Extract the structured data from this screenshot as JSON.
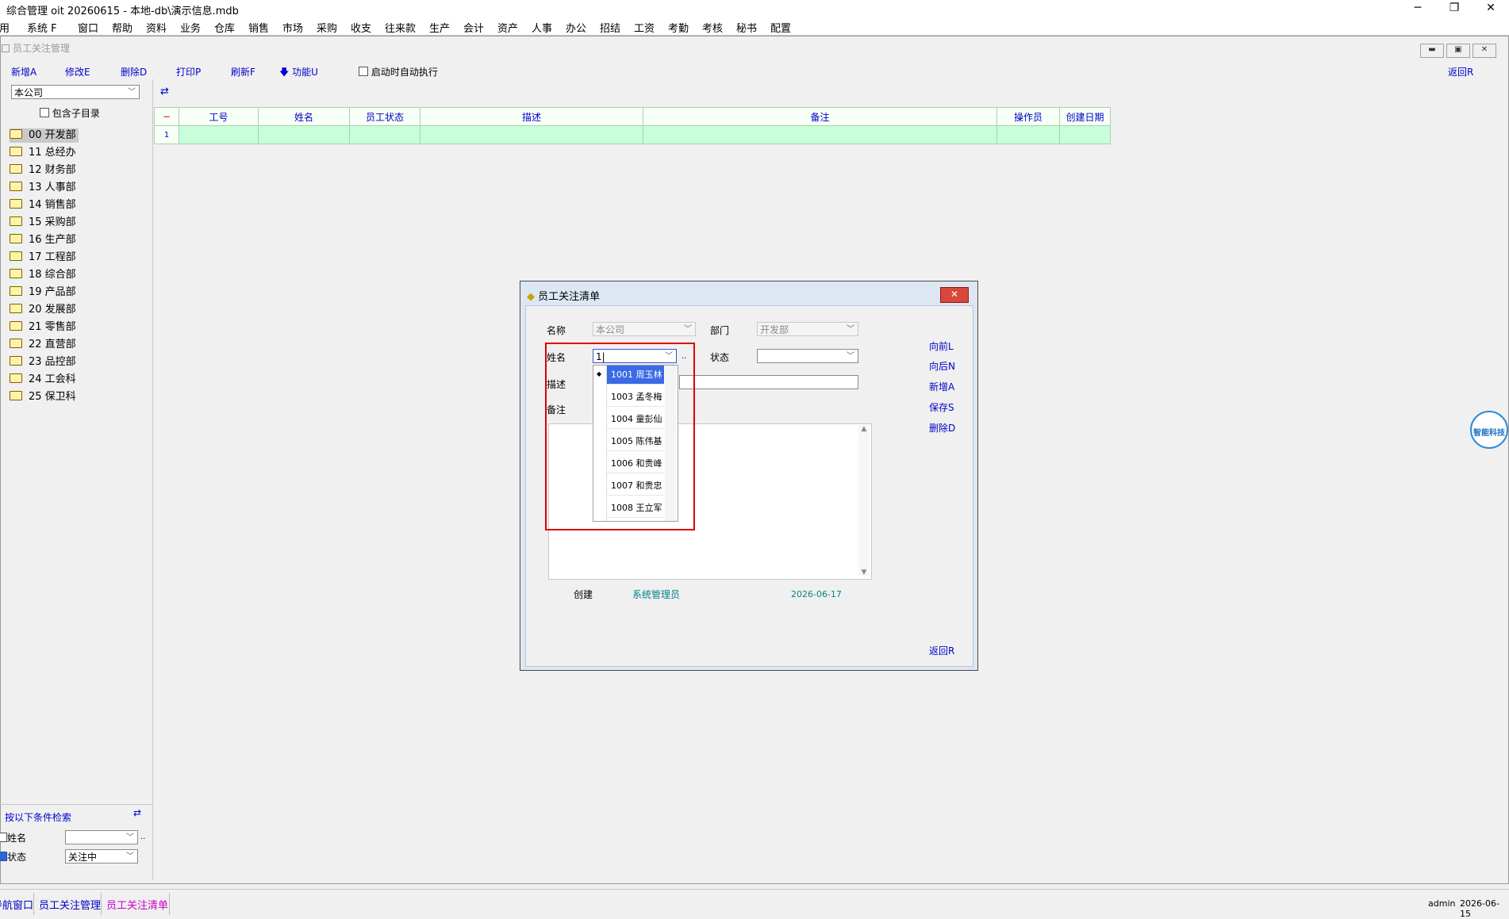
{
  "window": {
    "title": "综合管理 oit 20260615 - 本地-db\\演示信息.mdb",
    "min": "─",
    "max": "❐",
    "close": "✕"
  },
  "menu": [
    "常用",
    "系统 F",
    "窗口",
    "帮助",
    "资料",
    "业务",
    "仓库",
    "销售",
    "市场",
    "采购",
    "收支",
    "往来款",
    "生产",
    "会计",
    "资产",
    "人事",
    "办公",
    "招结",
    "工资",
    "考勤",
    "考核",
    "秘书",
    "配置"
  ],
  "child": {
    "title": "员工关注管理",
    "return": "返回R"
  },
  "toolbar": {
    "new": "新增A",
    "edit": "修改E",
    "delete": "删除D",
    "print": "打印P",
    "refresh": "刷新F",
    "func": "功能U",
    "auto_run": "启动时自动执行"
  },
  "company_combo": "本公司",
  "include_sub": "包含子目录",
  "tree": [
    "00 开发部",
    "11 总经办",
    "12 财务部",
    "13 人事部",
    "14 销售部",
    "15 采购部",
    "16 生产部",
    "17 工程部",
    "18 综合部",
    "19 产品部",
    "20 发展部",
    "21 零售部",
    "22 直营部",
    "23 品控部",
    "24 工会科",
    "25 保卫科"
  ],
  "grid": {
    "headers": [
      "−",
      "工号",
      "姓名",
      "员工状态",
      "描述",
      "备注",
      "操作员",
      "创建日期"
    ],
    "row_no": "1"
  },
  "search": {
    "title": "按以下条件检索",
    "name_label": "姓名",
    "status_label": "状态",
    "status_value": "关注中",
    "name_dots": ".."
  },
  "dialog": {
    "title": "员工关注清单",
    "name_label": "名称",
    "name_value": "本公司",
    "dept_label": "部门",
    "dept_value": "开发部",
    "person_label": "姓名",
    "person_value": "1|",
    "status_label": "状态",
    "desc_label": "描述",
    "remark_label": "备注",
    "dots": "..",
    "buttons": {
      "prev": "向前L",
      "next": "向后N",
      "new": "新增A",
      "save": "保存S",
      "delete": "删除D",
      "return": "返回R"
    },
    "created_label": "创建",
    "creator": "系统管理员",
    "created_date": "2026-06-17",
    "dropdown": [
      "1001 周玉林",
      "1003 孟冬梅",
      "1004 童彭仙",
      "1005 陈伟基",
      "1006 和贵峰",
      "1007 和贵忠",
      "1008 王立军"
    ]
  },
  "badge": "智能科技",
  "statusbar": {
    "tabs": [
      "导航窗口",
      "员工关注管理",
      "员工关注清单"
    ],
    "user": "admin",
    "date": "2026-06-15"
  },
  "colors": {
    "highlight": "#e00000",
    "link": "#0000cc",
    "grid_row": "#c7ffda"
  }
}
